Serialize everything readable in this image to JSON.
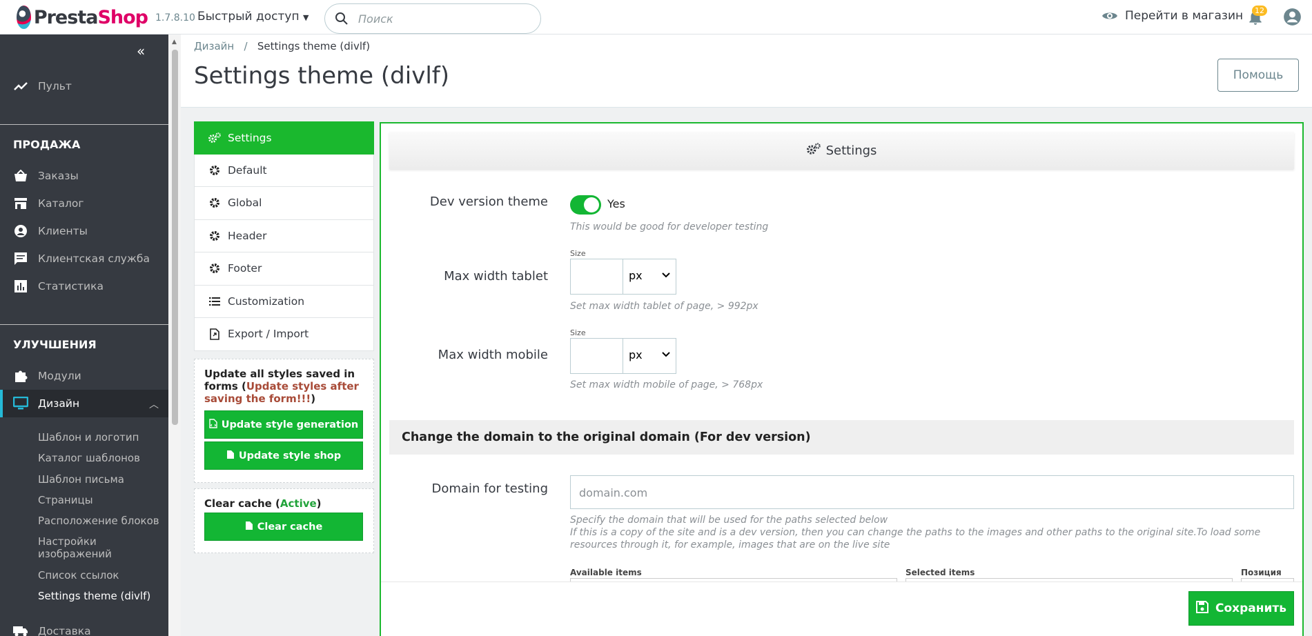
{
  "header": {
    "logo_text_dark": "Presta",
    "logo_text_pink": "Shop",
    "version": "1.7.8.10",
    "quick_access": "Быстрый доступ",
    "search_placeholder": "Поиск",
    "view_shop": "Перейти в магазин",
    "notification_count": "12"
  },
  "sidebar": {
    "dashboard": "Пульт",
    "section_sell": "ПРОДАЖА",
    "sell_items": [
      "Заказы",
      "Каталог",
      "Клиенты",
      "Клиентская служба",
      "Статистика"
    ],
    "section_improve": "УЛУЧШЕНИЯ",
    "modules": "Модули",
    "design": "Дизайн",
    "design_sub": [
      "Шаблон и логотип",
      "Каталог шаблонов",
      "Шаблон письма",
      "Страницы",
      "Расположение блоков",
      "Настройки изображений",
      "Список ссылок",
      "Settings theme (divlf)"
    ],
    "shipping": "Доставка"
  },
  "page": {
    "breadcrumb_parent": "Дизайн",
    "breadcrumb_sep": "/",
    "breadcrumb_current": "Settings theme (divlf)",
    "title": "Settings theme (divlf)",
    "help_button": "Помощь"
  },
  "tabs": [
    "Settings",
    "Default",
    "Global",
    "Header",
    "Footer",
    "Customization",
    "Export / Import"
  ],
  "update_box": {
    "text_part1": "Update all styles saved in forms (",
    "text_red": "Update styles after saving the form!!!",
    "text_part2": ")",
    "btn_generation": "Update style generation",
    "btn_shop": "Update style shop"
  },
  "cache_box": {
    "text_part1": "Clear cache (",
    "text_green": "Active",
    "text_part2": ")",
    "btn": "Clear cache"
  },
  "panel": {
    "heading": "Settings",
    "dev_label": "Dev version theme",
    "dev_value": "Yes",
    "dev_help": "This would be good for developer testing",
    "size_label": "Size",
    "tablet_label": "Max width tablet",
    "tablet_unit": "px",
    "tablet_help": "Set max width tablet of page, > 992px",
    "mobile_label": "Max width mobile",
    "mobile_unit": "px",
    "mobile_help": "Set max width mobile of page, > 768px",
    "section_title": "Change the domain to the original domain (For dev version)",
    "domain_label": "Domain for testing",
    "domain_placeholder": "domain.com",
    "domain_help1": "Specify the domain that will be used for the paths selected below",
    "domain_help2": "If this is a copy of the site and is a dev version, then you can change the paths to the images and other paths to the original site.To load some resources through it, for example, images that are on the live site",
    "available_items": "Available items",
    "selected_items": "Selected items",
    "position": "Позиция",
    "save_button": "Сохранить"
  },
  "colors": {
    "accent_green": "#13b634",
    "sidebar_bg": "#363a41",
    "active_blue": "#25b9d7",
    "brand_pink": "#df0067"
  }
}
